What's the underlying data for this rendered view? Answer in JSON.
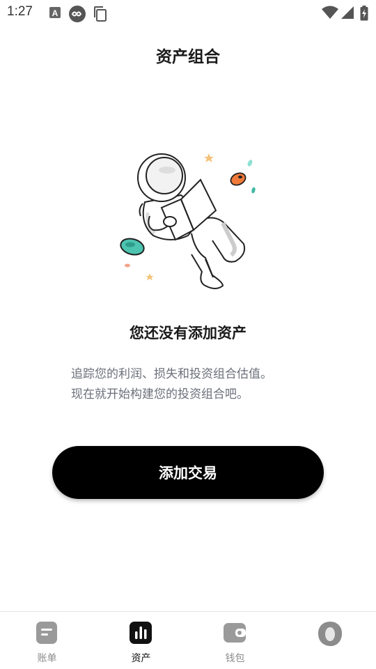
{
  "status_bar": {
    "time": "1:27",
    "left_icons": [
      "a-notification-icon",
      "infinity-app-icon",
      "copy-icon"
    ],
    "right_icons": [
      "wifi-icon",
      "signal-icon",
      "battery-charging-icon"
    ]
  },
  "header": {
    "title": "资产组合"
  },
  "empty_state": {
    "illustration": "astronaut-reading-icon",
    "title": "您还没有添加资产",
    "description_line1": "追踪您的利润、损失和投资组合估值。",
    "description_line2": "现在就开始构建您的投资组合吧。"
  },
  "actions": {
    "add_trade_label": "添加交易"
  },
  "bottom_nav": {
    "items": [
      {
        "label": "账单",
        "icon": "bill-icon",
        "active": false
      },
      {
        "label": "资产",
        "icon": "bar-chart-icon",
        "active": true
      },
      {
        "label": "钱包",
        "icon": "wallet-icon",
        "active": false
      },
      {
        "label": "",
        "icon": "profile-blob-icon",
        "active": false
      }
    ]
  },
  "colors": {
    "primary_button": "#000000",
    "text_primary": "#1a1a1a",
    "text_secondary": "#6b6f7a",
    "nav_inactive": "#8c8c8c",
    "accent_teal": "#4cc4b0",
    "accent_orange": "#f07a3a"
  }
}
